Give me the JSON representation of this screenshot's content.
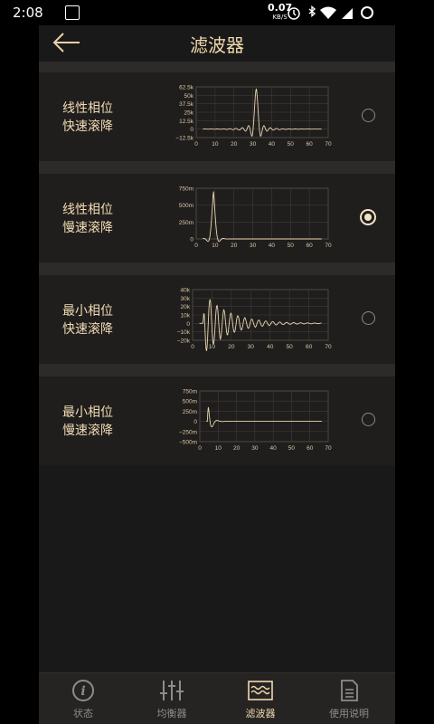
{
  "status_bar": {
    "time": "2:08",
    "net_speed": "0.07",
    "net_unit": "KB/S"
  },
  "header": {
    "title": "滤波器"
  },
  "filters": [
    {
      "line1": "线性相位",
      "line2": "快速滚降",
      "selected": false,
      "y_ticks": [
        "62.5k",
        "50k",
        "37.5k",
        "25k",
        "12.5k",
        "0",
        "−12.5k"
      ],
      "x_ticks": [
        "0",
        "10",
        "20",
        "30",
        "40",
        "50",
        "60",
        "70"
      ]
    },
    {
      "line1": "线性相位",
      "line2": "慢速滚降",
      "selected": true,
      "y_ticks": [
        "750m",
        "500m",
        "250m",
        "0"
      ],
      "x_ticks": [
        "0",
        "10",
        "20",
        "30",
        "40",
        "50",
        "60",
        "70"
      ]
    },
    {
      "line1": "最小相位",
      "line2": "快速滚降",
      "selected": false,
      "y_ticks": [
        "40k",
        "30k",
        "20k",
        "10k",
        "0",
        "−10k",
        "−20k"
      ],
      "x_ticks": [
        "0",
        "10",
        "20",
        "30",
        "40",
        "50",
        "60",
        "70"
      ]
    },
    {
      "line1": "最小相位",
      "line2": "慢速滚降",
      "selected": false,
      "y_ticks": [
        "750m",
        "500m",
        "250m",
        "0",
        "−250m",
        "−500m"
      ],
      "x_ticks": [
        "0",
        "10",
        "20",
        "30",
        "40",
        "50",
        "60",
        "70"
      ]
    }
  ],
  "tabs": [
    {
      "label": "状态",
      "icon": "info-icon",
      "active": false
    },
    {
      "label": "均衡器",
      "icon": "equalizer-icon",
      "active": false
    },
    {
      "label": "滤波器",
      "icon": "filter-icon",
      "active": true
    },
    {
      "label": "使用说明",
      "icon": "document-icon",
      "active": false
    }
  ],
  "colors": {
    "accent": "#f0d9ad",
    "card_bg": "#201e1d",
    "screen_bg": "#1a1919"
  }
}
